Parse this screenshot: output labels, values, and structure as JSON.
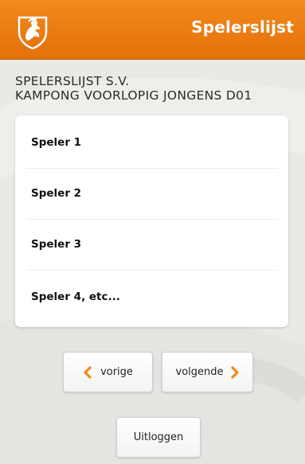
{
  "header": {
    "title": "Spelerslijst",
    "logo_icon": "lion-crest-icon",
    "accent": "#ee8012"
  },
  "subtitle": {
    "line1": "SPELERSLIJST S.V.",
    "line2": "KAMPONG VOORLOPIG JONGENS D01"
  },
  "players": [
    {
      "label": "Speler 1"
    },
    {
      "label": "Speler 2"
    },
    {
      "label": "Speler 3"
    },
    {
      "label": "Speler 4, etc..."
    }
  ],
  "nav": {
    "prev_label": "vorige",
    "next_label": "volgende",
    "prev_icon": "chevron-left-icon",
    "next_icon": "chevron-right-icon"
  },
  "logout_label": "Uitloggen"
}
